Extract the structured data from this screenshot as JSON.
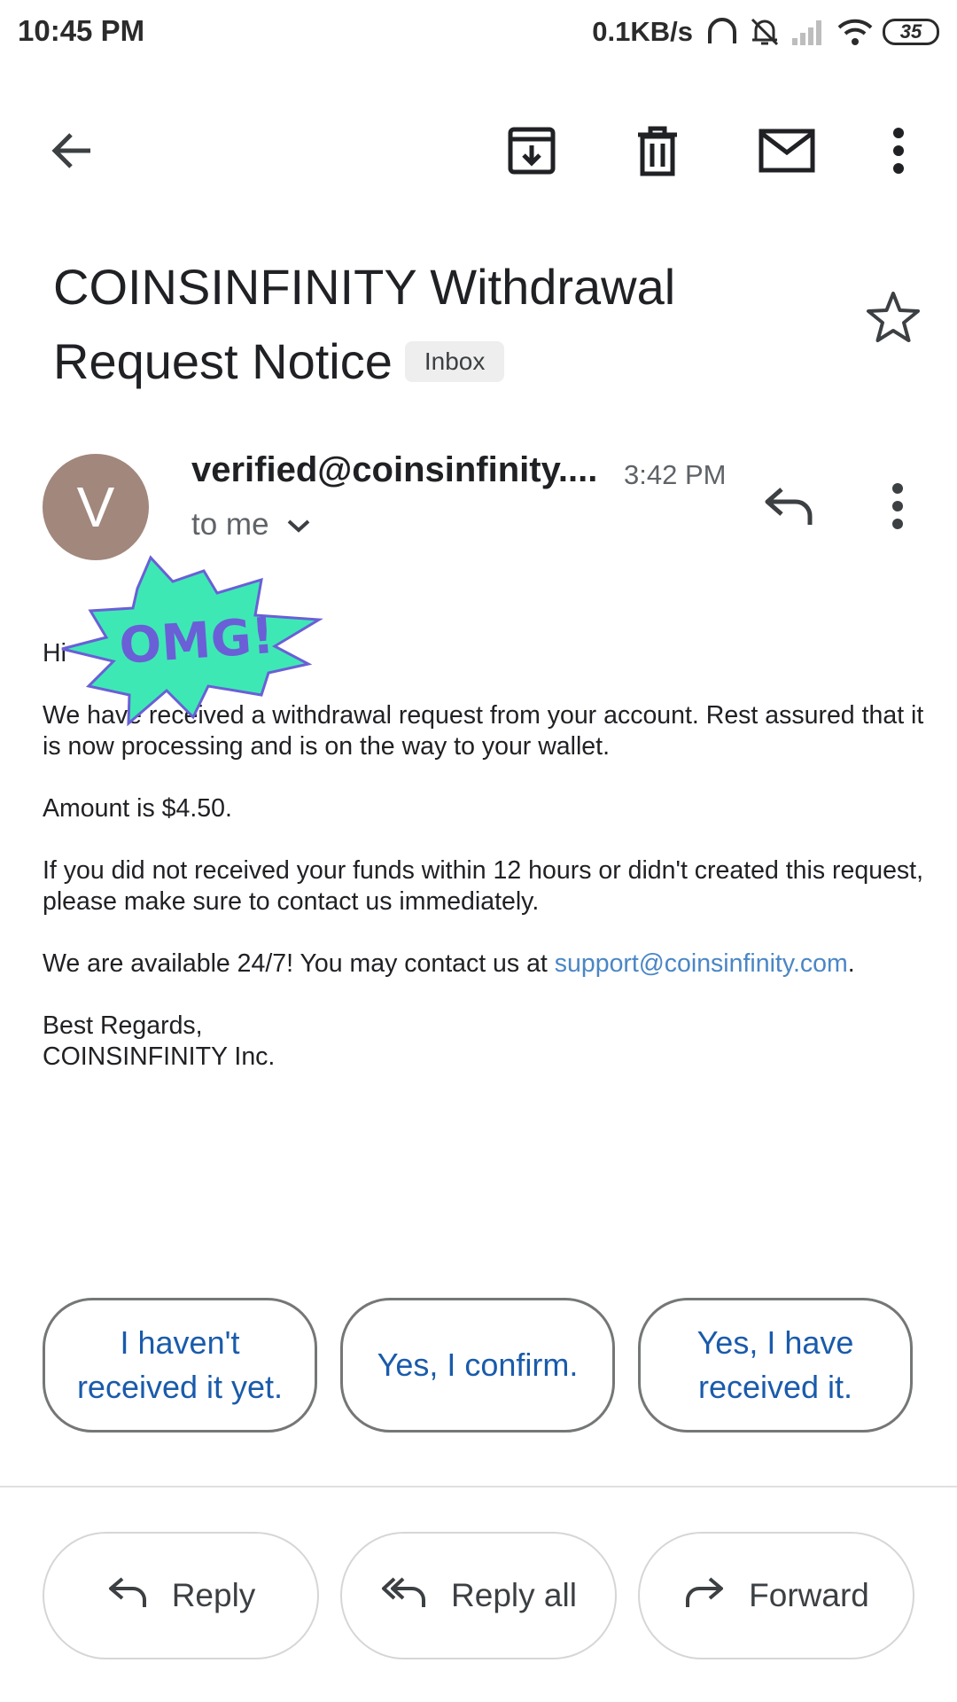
{
  "status_bar": {
    "time": "10:45 PM",
    "speed": "0.1KB/s",
    "battery": "35",
    "icons": [
      "headphones-icon",
      "bell-off-icon",
      "signal-icon",
      "wifi-icon",
      "battery-icon"
    ]
  },
  "toolbar": {
    "icons": [
      "back-arrow-icon",
      "archive-icon",
      "delete-icon",
      "mark-unread-icon",
      "more-vert-icon"
    ]
  },
  "email": {
    "subject_line1": "COINSINFINITY Withdrawal",
    "subject_line2": "Request Notice",
    "label": "Inbox",
    "avatar_letter": "V",
    "avatar_color": "#a1877c",
    "sender": "verified@coinsinfinity....",
    "time": "3:42 PM",
    "recipient": "to me",
    "sticker_text": "OMG!",
    "body": {
      "greeting": "Hi",
      "para1": "We have received a withdrawal request from your account. Rest assured that it is now processing and is on the way to your wallet.",
      "para2": "Amount is $4.50.",
      "para3": "If you did not received your funds within 12 hours or didn't created this request, please make sure to contact us immediately.",
      "para4_prefix": "We are available 24/7! You may contact us at ",
      "para4_link": "support@coinsinfinity.com",
      "para4_suffix": ".",
      "signoff": "Best Regards,",
      "company": "COINSINFINITY Inc."
    }
  },
  "smart_replies": [
    {
      "line1": "I haven't",
      "line2": "received it yet."
    },
    {
      "line1": "Yes, I confirm.",
      "line2": ""
    },
    {
      "line1": "Yes, I have",
      "line2": "received it."
    }
  ],
  "actions": {
    "reply": "Reply",
    "reply_all": "Reply all",
    "forward": "Forward"
  },
  "colors": {
    "accent_link": "#4a86c5",
    "smart_reply_text": "#1a5bab",
    "sticker_fill": "#3ee8b5",
    "sticker_text": "#6a5fd6"
  }
}
